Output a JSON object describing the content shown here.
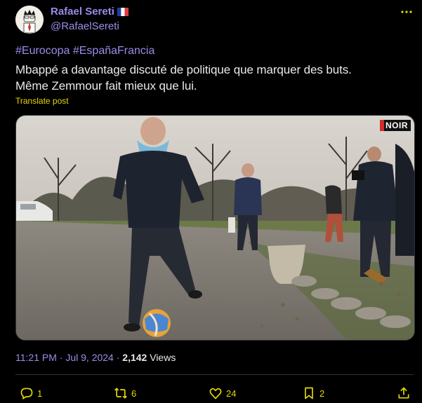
{
  "author": {
    "name": "Rafael Sereti",
    "handle": "@RafaelSereti"
  },
  "post": {
    "hashtags": [
      "#Eurocopa",
      "#EspañaFrancia"
    ],
    "line1": "Mbappé a davantage discuté de politique que marquer des buts.",
    "line2": "Même Zemmour fait mieux que lui.",
    "translate_label": "Translate post",
    "video_watermark": "NOIR",
    "time": "11:21 PM",
    "separator": "·",
    "date": "Jul 9, 2024",
    "views_count": "2,142",
    "views_label": "Views"
  },
  "actions": {
    "replies": "1",
    "reposts": "6",
    "likes": "24",
    "bookmarks": "2"
  },
  "colors": {
    "accent": "#9b8ce9",
    "icon": "#e7d900",
    "background": "#000000"
  },
  "icons": [
    "more-icon",
    "reply-icon",
    "repost-icon",
    "like-icon",
    "bookmark-icon",
    "share-icon",
    "france-flag-icon"
  ]
}
